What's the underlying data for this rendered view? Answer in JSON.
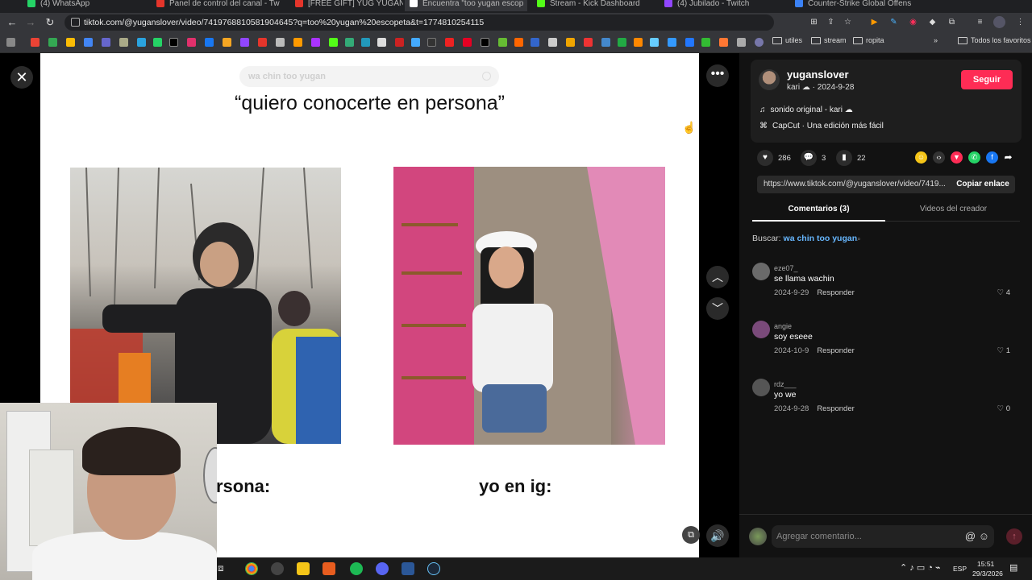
{
  "browser": {
    "tabs": [
      {
        "label": "(4) WhatsApp",
        "color": "#25d366"
      },
      {
        "label": "Panel de control del canal - Tw",
        "color": "#e5352b"
      },
      {
        "label": "[FREE GIFT] YUG YUGAN VS HO",
        "color": "#e5352b"
      },
      {
        "label": "Encuentra \"too yugan escop",
        "color": "#ffffff",
        "active": true
      },
      {
        "label": "Stream - Kick Dashboard",
        "color": "#53fc18"
      },
      {
        "label": "(4) Jubilado - Twitch",
        "color": "#9146ff"
      },
      {
        "label": "Counter-Strike Global Offensive",
        "color": "#3b82f6"
      }
    ],
    "url": "tiktok.com/@yuganslover/video/7419768810581904645?q=too%20yugan%20escopeta&t=1774810254115",
    "bookmarks": [
      "utiles",
      "stream",
      "ropita"
    ],
    "all_bookmarks": "Todos los favoritos"
  },
  "video": {
    "search_text": "wa chin too yugan",
    "caption_top": "“quiero conocerte en persona”",
    "label_left": "rsona:",
    "label_right": "yo en ig:"
  },
  "creator": {
    "username": "yuganslover",
    "nickname": "kari ☁",
    "date": "2024-9-28",
    "follow_label": "Seguir",
    "sound": "sonido original - kari ☁",
    "capcut": "CapCut · Una edición más fácil"
  },
  "stats": {
    "likes": "286",
    "comments": "3",
    "saves": "22"
  },
  "link": {
    "url": "https://www.tiktok.com/@yuganslover/video/7419...",
    "copy_label": "Copiar enlace"
  },
  "tabs": {
    "comments": "Comentarios (3)",
    "creator_videos": "Videos del creador"
  },
  "search_hint": {
    "prefix": "Buscar:",
    "query": "wa chin too yugan"
  },
  "comments": [
    {
      "user": "eze07_",
      "text": "se llama wachin",
      "date": "2024-9-29",
      "reply": "Responder",
      "likes": "4",
      "avatar": "#6a6a6a"
    },
    {
      "user": "angie",
      "text": "soy eseee",
      "date": "2024-10-9",
      "reply": "Responder",
      "likes": "1",
      "avatar": "#7a4a7a"
    },
    {
      "user": "rdz___",
      "text": "yo we",
      "date": "2024-9-28",
      "reply": "Responder",
      "likes": "0",
      "avatar": "#555555"
    }
  ],
  "comment_input": {
    "placeholder": "Agregar comentario..."
  },
  "taskbar": {
    "lang": "ESP",
    "time": "15:51",
    "date": "29/3/2026"
  },
  "colors": {
    "accent": "#fe2c55",
    "link_blue": "#67b7ff"
  }
}
